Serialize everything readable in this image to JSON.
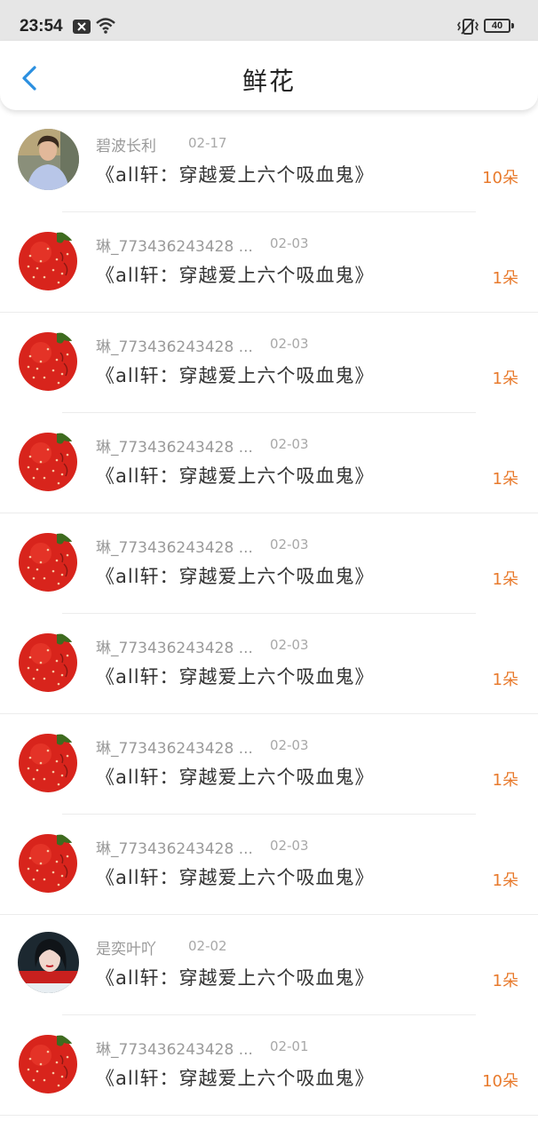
{
  "status_bar": {
    "time": "23:54",
    "battery": "40"
  },
  "header": {
    "title": "鲜花"
  },
  "rows": [
    {
      "user": "碧波长利",
      "date": "02-17",
      "book": "《all轩：穿越爱上六个吸血鬼》",
      "count": "10朵",
      "avatar": "person"
    },
    {
      "user": "琳_773436243428 ...",
      "date": "02-03",
      "book": "《all轩：穿越爱上六个吸血鬼》",
      "count": "1朵",
      "avatar": "strawberry"
    },
    {
      "user": "琳_773436243428 ...",
      "date": "02-03",
      "book": "《all轩：穿越爱上六个吸血鬼》",
      "count": "1朵",
      "avatar": "strawberry"
    },
    {
      "user": "琳_773436243428 ...",
      "date": "02-03",
      "book": "《all轩：穿越爱上六个吸血鬼》",
      "count": "1朵",
      "avatar": "strawberry"
    },
    {
      "user": "琳_773436243428 ...",
      "date": "02-03",
      "book": "《all轩：穿越爱上六个吸血鬼》",
      "count": "1朵",
      "avatar": "strawberry"
    },
    {
      "user": "琳_773436243428 ...",
      "date": "02-03",
      "book": "《all轩：穿越爱上六个吸血鬼》",
      "count": "1朵",
      "avatar": "strawberry"
    },
    {
      "user": "琳_773436243428 ...",
      "date": "02-03",
      "book": "《all轩：穿越爱上六个吸血鬼》",
      "count": "1朵",
      "avatar": "strawberry"
    },
    {
      "user": "琳_773436243428 ...",
      "date": "02-03",
      "book": "《all轩：穿越爱上六个吸血鬼》",
      "count": "1朵",
      "avatar": "strawberry"
    },
    {
      "user": "是奕叶吖",
      "date": "02-02",
      "book": "《all轩：穿越爱上六个吸血鬼》",
      "count": "1朵",
      "avatar": "woman"
    },
    {
      "user": "琳_773436243428 ...",
      "date": "02-01",
      "book": "《all轩：穿越爱上六个吸血鬼》",
      "count": "10朵",
      "avatar": "strawberry"
    }
  ],
  "colors": {
    "accent": "#2b8fe0",
    "count": "#e87a2c",
    "username": "#9a9a9a",
    "title": "#333333"
  }
}
